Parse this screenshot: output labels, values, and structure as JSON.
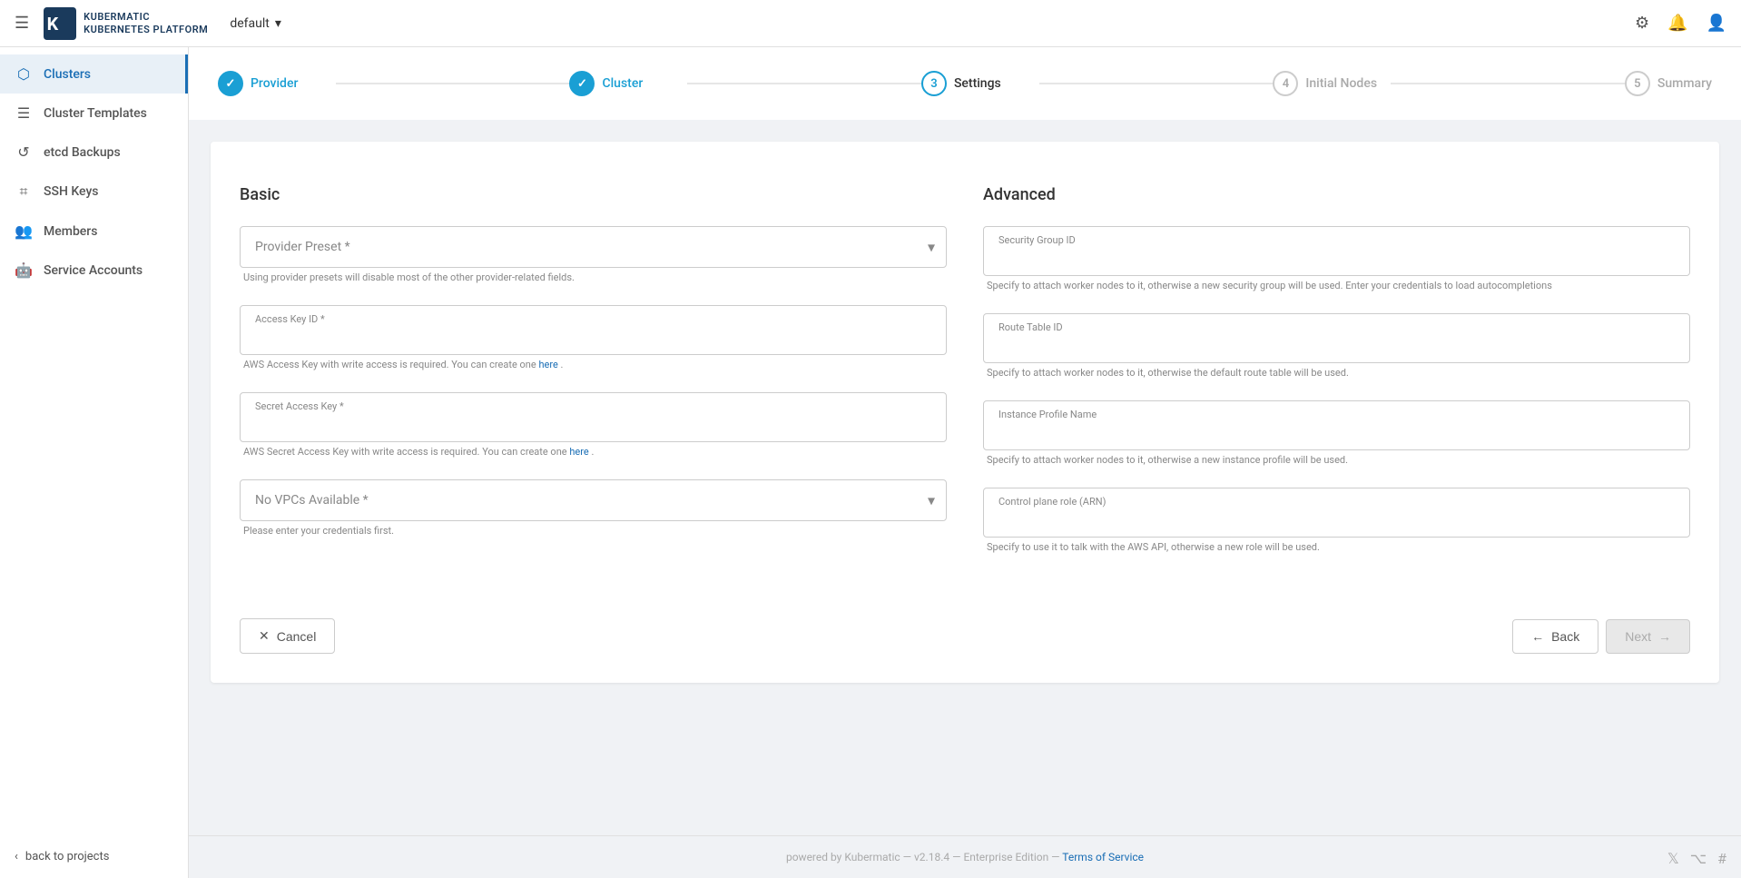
{
  "navbar": {
    "menu_label": "Menu",
    "brand_top": "KUBERMATIC",
    "brand_bottom": "Kubernetes Platform",
    "project_name": "default",
    "settings_icon": "⚙",
    "notifications_icon": "🔔",
    "user_icon": "👤"
  },
  "sidebar": {
    "items": [
      {
        "id": "clusters",
        "label": "Clusters",
        "icon": "⬡",
        "active": true
      },
      {
        "id": "cluster-templates",
        "label": "Cluster Templates",
        "icon": "☰",
        "active": false
      },
      {
        "id": "etcd-backups",
        "label": "etcd Backups",
        "icon": "↺",
        "active": false
      },
      {
        "id": "ssh-keys",
        "label": "SSH Keys",
        "icon": "⌗",
        "active": false
      },
      {
        "id": "members",
        "label": "Members",
        "icon": "👥",
        "active": false
      },
      {
        "id": "service-accounts",
        "label": "Service Accounts",
        "icon": "🤖",
        "active": false
      }
    ],
    "back_label": "back to projects"
  },
  "stepper": {
    "steps": [
      {
        "id": "provider",
        "label": "Provider",
        "number": "✓",
        "state": "completed"
      },
      {
        "id": "cluster",
        "label": "Cluster",
        "number": "✓",
        "state": "completed"
      },
      {
        "id": "settings",
        "label": "Settings",
        "number": "3",
        "state": "active"
      },
      {
        "id": "initial-nodes",
        "label": "Initial Nodes",
        "number": "4",
        "state": "inactive"
      },
      {
        "id": "summary",
        "label": "Summary",
        "number": "5",
        "state": "inactive"
      }
    ]
  },
  "basic": {
    "title": "Basic",
    "provider_preset": {
      "label": "Provider Preset *",
      "placeholder": "Provider Preset *",
      "helper": "Using provider presets will disable most of the other provider-related fields."
    },
    "access_key_id": {
      "label": "Access Key ID *",
      "placeholder": "Access Key ID *",
      "helper": "AWS Access Key with write access is required. You can create one",
      "helper_link": "here",
      "helper_suffix": "."
    },
    "secret_access_key": {
      "label": "Secret Access Key *",
      "placeholder": "Secret Access Key *",
      "helper": "AWS Secret Access Key with write access is required. You can create one",
      "helper_link": "here",
      "helper_suffix": "."
    },
    "vpc": {
      "label": "No VPCs Available *",
      "placeholder": "No VPCs Available *",
      "helper": "Please enter your credentials first."
    }
  },
  "advanced": {
    "title": "Advanced",
    "security_group": {
      "label": "Security Group ID",
      "placeholder": "Security Group ID",
      "helper": "Specify to attach worker nodes to it, otherwise a new security group will be used.   Enter your credentials to load autocompletions"
    },
    "route_table": {
      "label": "Route Table ID",
      "placeholder": "Route Table ID",
      "helper": "Specify to attach worker nodes to it, otherwise the default route table will be used."
    },
    "instance_profile": {
      "label": "Instance Profile Name",
      "placeholder": "Instance Profile Name",
      "helper": "Specify to attach worker nodes to it, otherwise a new instance profile will be used."
    },
    "control_plane_role": {
      "label": "Control plane role (ARN)",
      "placeholder": "Control plane role (ARN)",
      "helper": "Specify to use it to talk with the AWS API, otherwise a new role will be used."
    }
  },
  "buttons": {
    "cancel": "Cancel",
    "back": "Back",
    "next": "Next"
  },
  "footer": {
    "text": "powered by Kubermatic — v2.18.4 — Enterprise Edition — ",
    "tos_label": "Terms of Service"
  }
}
